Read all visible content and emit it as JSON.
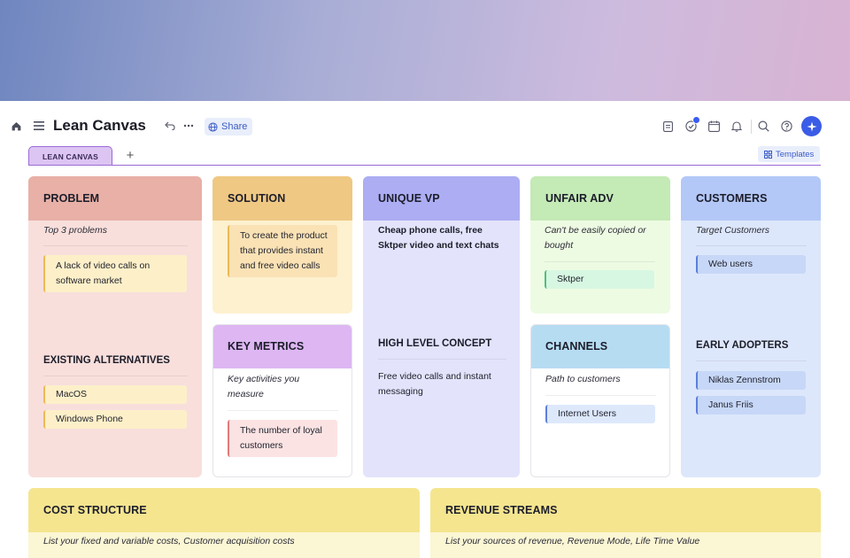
{
  "toolbar": {
    "title": "Lean Canvas",
    "share_label": "Share",
    "templates_label": "Templates",
    "icons": [
      "home-icon",
      "menu-icon",
      "undo-icon",
      "more-icon",
      "globe-icon",
      "clipboard-icon",
      "check-circle-icon",
      "calendar-icon",
      "bell-icon",
      "search-icon",
      "help-icon",
      "ai-sparkle-icon"
    ]
  },
  "tabs": [
    {
      "label": "LEAN CANVAS"
    }
  ],
  "colors": {
    "accent": "#3b5ce6",
    "tab_active": "#dcc4f3",
    "problem_head": "#e8b0a6",
    "problem_body": "#f8dfdc",
    "solution_head": "#efc883",
    "solution_body": "#fdf1cf",
    "uvp_head": "#acadf2",
    "uvp_body": "#e3e3fb",
    "unfair_head": "#c4eab6",
    "unfair_body": "#eefbe3",
    "customers_head": "#b3c8f7",
    "customers_body": "#dde7fb",
    "metrics_head": "#ddb6f2",
    "channels_head": "#b6dcf2",
    "cost_head": "#f5e58f",
    "cost_body": "#fbf6d4"
  },
  "problem": {
    "title": "PROBLEM",
    "subtitle": "Top 3 problems",
    "stickies": [
      "A lack of video calls on software market"
    ],
    "alt_title": "EXISTING ALTERNATIVES",
    "alt_stickies": [
      "MacOS",
      "Windows Phone"
    ]
  },
  "solution": {
    "title": "SOLUTION",
    "stickies": [
      "To create the product that provides instant and free video calls"
    ]
  },
  "metrics": {
    "title": "KEY METRICS",
    "subtitle": "Key activities you measure",
    "stickies": [
      "The number of loyal customers"
    ]
  },
  "uvp": {
    "title": "UNIQUE VP",
    "text": "Cheap phone calls, free Sktper video and text chats",
    "hlc_title": "HIGH LEVEL CONCEPT",
    "hlc_text": "Free video calls and instant messaging"
  },
  "unfair": {
    "title": "UNFAIR ADV",
    "subtitle": "Can't be easily copied or bought",
    "stickies": [
      "Sktper"
    ]
  },
  "channels": {
    "title": "CHANNELS",
    "subtitle": "Path to customers",
    "stickies": [
      "Internet Users"
    ]
  },
  "customers": {
    "title": "CUSTOMERS",
    "subtitle": "Target Customers",
    "stickies": [
      "Web users"
    ],
    "early_title": "EARLY ADOPTERS",
    "early_stickies": [
      "Niklas Zennstrom",
      "Janus Friis"
    ]
  },
  "cost": {
    "title": "COST STRUCTURE",
    "subtitle": "List your fixed and variable costs, Customer acquisition costs"
  },
  "revenue": {
    "title": "REVENUE STREAMS",
    "subtitle": "List your sources of revenue, Revenue Mode, Life Time Value"
  }
}
